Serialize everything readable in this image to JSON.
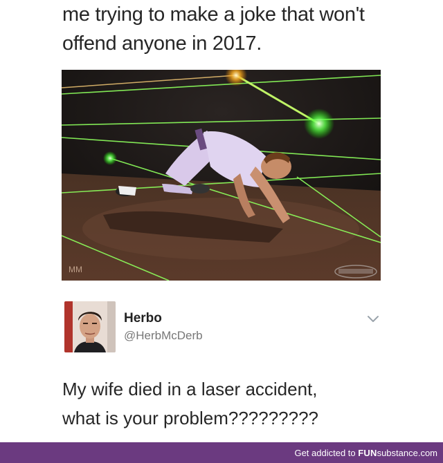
{
  "caption": {
    "line1": "me trying to make a joke that won't",
    "line2": "offend anyone in 2017."
  },
  "image": {
    "description_icon": "laser-maze-photo",
    "watermark_left": "MM"
  },
  "tweet": {
    "author_name": "Herbo",
    "author_handle": "@HerbMcDerb",
    "text_line1": "My wife died in a laser accident,",
    "text_line2": "what is your problem?????????",
    "menu_icon": "chevron-down-icon"
  },
  "footer": {
    "prefix": "Get addicted to ",
    "brand_bold": "FUN",
    "brand_rest": "substance",
    "domain": ".com",
    "background": "#6b3a80"
  }
}
